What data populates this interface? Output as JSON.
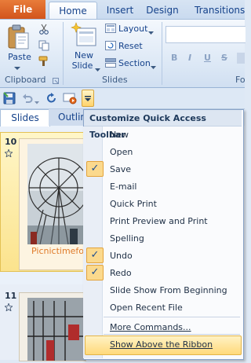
{
  "ribbon": {
    "tabs": [
      "File",
      "Home",
      "Insert",
      "Design",
      "Transitions"
    ],
    "clipboard": {
      "paste_label": "Paste",
      "group_label": "Clipboard"
    },
    "slides": {
      "new_slide_line1": "New",
      "new_slide_line2": "Slide",
      "layout_label": "Layout",
      "reset_label": "Reset",
      "section_label": "Section",
      "group_label": "Slides"
    },
    "font": {
      "bold": "B",
      "italic": "I",
      "underline": "U",
      "strike": "S",
      "group_label_partial": "Fo"
    }
  },
  "left_pane": {
    "tabs": [
      "Slides",
      "Outlin"
    ],
    "slides": [
      {
        "number": "10",
        "caption": "Picnictimefo"
      },
      {
        "number": "11"
      }
    ]
  },
  "qat_menu": {
    "title": "Customize Quick Access Toolbar",
    "items": [
      {
        "label": "New",
        "checked": false
      },
      {
        "label": "Open",
        "checked": false
      },
      {
        "label": "Save",
        "checked": true
      },
      {
        "label": "E-mail",
        "checked": false
      },
      {
        "label": "Quick Print",
        "checked": false
      },
      {
        "label": "Print Preview and Print",
        "checked": false
      },
      {
        "label": "Spelling",
        "checked": false
      },
      {
        "label": "Undo",
        "checked": true
      },
      {
        "label": "Redo",
        "checked": true
      },
      {
        "label": "Slide Show From Beginning",
        "checked": false
      },
      {
        "label": "Open Recent File",
        "checked": false
      }
    ],
    "more_commands": "More Commands...",
    "show_above": "Show Above the Ribbon",
    "check_glyph": "✓"
  },
  "colors": {
    "file_tab": "#d8632a",
    "highlight": "#ffd97a",
    "check_bg": "#fbd98d"
  }
}
